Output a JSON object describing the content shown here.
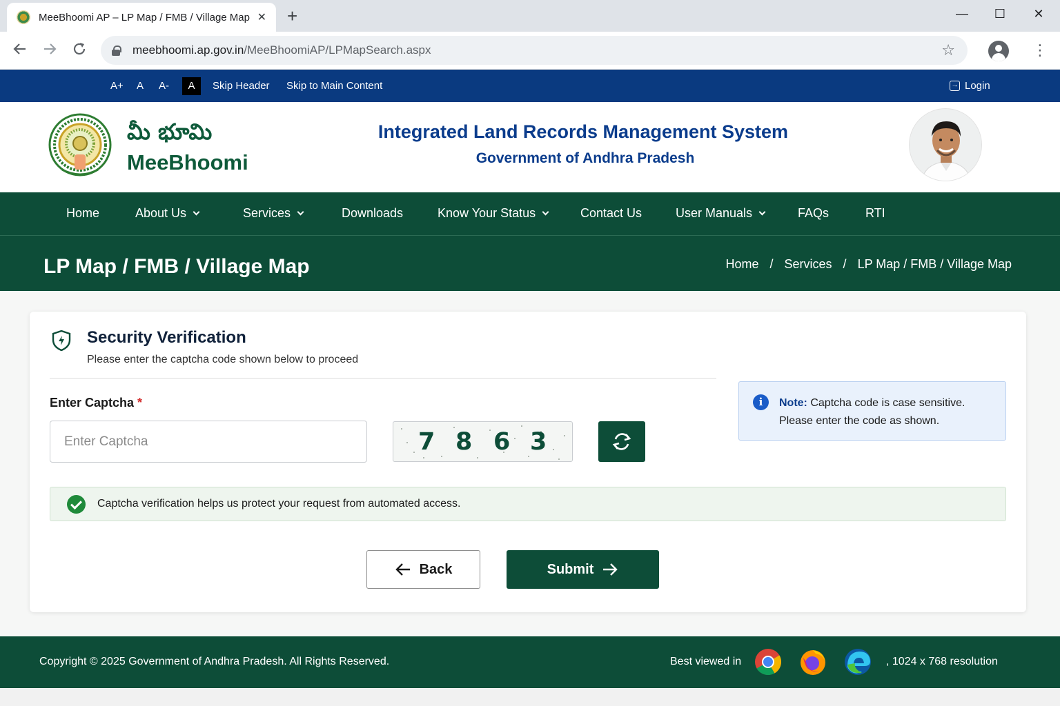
{
  "browser": {
    "tab_title": "MeeBhoomi AP – LP Map / FMB / Village Map",
    "tab_close": "✕",
    "new_tab": "+",
    "url_host": "meebhoomi.ap.gov.in",
    "url_path": "/MeeBhoomiAP/LPMapSearch.aspx",
    "window_controls": {
      "minimize": "—",
      "maximize": "☐",
      "close": "✕"
    }
  },
  "utility_bar": {
    "font_increase": "A+",
    "font_normal": "A",
    "font_decrease": "A-",
    "contrast": "A",
    "skip_header": "Skip Header",
    "skip_main": "Skip to Main Content",
    "login": "Login"
  },
  "header": {
    "brand_telugu": "మీ భూమి",
    "brand_name": "MeeBhoomi",
    "system_title": "Integrated Land Records Management System",
    "government": "Government of Andhra Pradesh"
  },
  "nav": {
    "home": "Home",
    "about": "About Us",
    "services": "Services",
    "downloads": "Downloads",
    "status": "Know Your Status",
    "contact": "Contact Us",
    "manuals": "User Manuals",
    "faqs": "FAQs",
    "rti": "RTI"
  },
  "page": {
    "title": "LP Map / FMB / Village Map",
    "breadcrumb": [
      "Home",
      "Services",
      "LP Map / FMB / Village Map"
    ],
    "breadcrumb_sep": "/"
  },
  "verification": {
    "title": "Security Verification",
    "subtitle": "Please enter the captcha code shown below to proceed",
    "captcha_label": "Enter Captcha",
    "required_mark": "*",
    "captcha_placeholder": "Enter Captcha",
    "captcha_digits": [
      "7",
      "8",
      "6",
      "3"
    ],
    "note_label": "Note:",
    "note_line1": " Captcha code is case sensitive.",
    "note_line2": "Please enter the code as shown.",
    "info_text": "Captcha verification helps us protect your request from automated access.",
    "back_label": "Back",
    "submit_label": "Submit"
  },
  "footer": {
    "copyright": "Copyright © 2025 Government of Andhra Pradesh. All Rights Reserved.",
    "best_viewed": "Best viewed in",
    "resolution": ", 1024 x 768 resolution",
    "browsers": [
      "chrome-icon",
      "firefox-icon",
      "edge-icon"
    ]
  },
  "colors": {
    "primary_green": "#0d4d38",
    "utility_blue": "#0a3a80",
    "heading_blue": "#0b3c8c",
    "success_green": "#1f8a3a",
    "info_blue": "#1a5cc8"
  }
}
